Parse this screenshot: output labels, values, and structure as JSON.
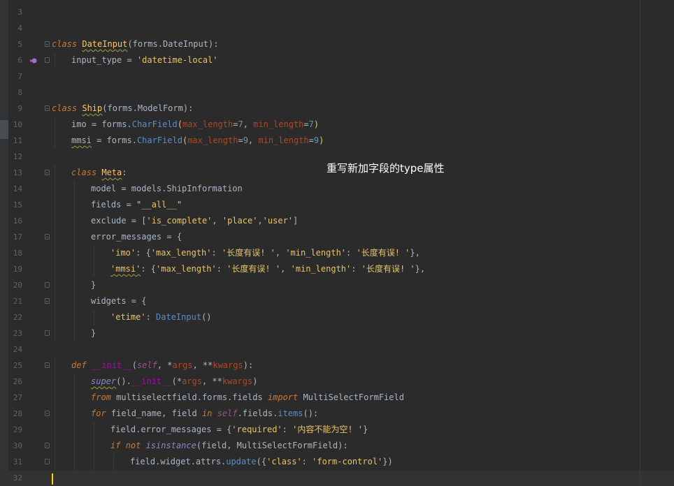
{
  "editor": {
    "language": "python",
    "colors": {
      "background": "#2b2b2b",
      "keyword": "#cc7832",
      "string": "#6a8759",
      "number": "#6897bb",
      "function_call": "#5a8dc7",
      "caret": "#ffd700"
    },
    "annotation": "重写新加字段的type属性",
    "lines": [
      {
        "n": "3"
      },
      {
        "n": "4"
      },
      {
        "n": "5"
      },
      {
        "n": "6"
      },
      {
        "n": "7"
      },
      {
        "n": "8"
      },
      {
        "n": "9"
      },
      {
        "n": "10"
      },
      {
        "n": "11"
      },
      {
        "n": "12"
      },
      {
        "n": "13"
      },
      {
        "n": "14"
      },
      {
        "n": "15"
      },
      {
        "n": "16"
      },
      {
        "n": "17"
      },
      {
        "n": "18"
      },
      {
        "n": "19"
      },
      {
        "n": "20"
      },
      {
        "n": "21"
      },
      {
        "n": "22"
      },
      {
        "n": "23"
      },
      {
        "n": "24"
      },
      {
        "n": "25"
      },
      {
        "n": "26"
      },
      {
        "n": "27"
      },
      {
        "n": "28"
      },
      {
        "n": "29"
      },
      {
        "n": "30"
      },
      {
        "n": "31"
      },
      {
        "n": "32"
      }
    ],
    "tokens": {
      "l5": [
        "class",
        " ",
        "DateInput",
        "(forms.DateInput):"
      ],
      "l6": [
        "input_type",
        " = ",
        "'datetime-local'"
      ],
      "l9": [
        "class",
        " ",
        "Ship",
        "(forms.ModelForm):"
      ],
      "l10": [
        "imo",
        " = forms.",
        "CharField",
        "(",
        "max_length",
        "=",
        "7",
        ", ",
        "min_length",
        "=",
        "7",
        ")"
      ],
      "l11": [
        "mmsi",
        " = forms.",
        "CharField",
        "(",
        "max_length",
        "=",
        "9",
        ", ",
        "min_length",
        "=",
        "9",
        ")"
      ],
      "l13": [
        "class",
        " ",
        "Meta",
        ":"
      ],
      "l14": [
        "model = models.ShipInformation"
      ],
      "l15": [
        "fields = ",
        "\"__all__\""
      ],
      "l16": [
        "exclude = [",
        "'is_complete'",
        ", ",
        "'place'",
        ",",
        "'user'",
        "]"
      ],
      "l17": [
        "error_messages = {"
      ],
      "l18": [
        "'imo'",
        ": {",
        "'max_length'",
        ": ",
        "'长度有误! '",
        ", ",
        "'min_length'",
        ": ",
        "'长度有误! '",
        "},"
      ],
      "l19": [
        "'mmsi'",
        ": {",
        "'max_length'",
        ": ",
        "'长度有误! '",
        ", ",
        "'min_length'",
        ": ",
        "'长度有误! '",
        "},"
      ],
      "l20": [
        "}"
      ],
      "l21": [
        "widgets = {"
      ],
      "l22": [
        "'etime'",
        ": ",
        "DateInput",
        "()"
      ],
      "l23": [
        "}"
      ],
      "l25": [
        "def",
        " ",
        "__init__",
        "(",
        "self",
        ", *",
        "args",
        ", **",
        "kwargs",
        "):"
      ],
      "l26": [
        "super",
        "().",
        "__init__",
        "(*",
        "args",
        ", **",
        "kwargs",
        ")"
      ],
      "l27": [
        "from",
        " multiselectfield.forms.fields ",
        "import",
        " MultiSelectFormField"
      ],
      "l28": [
        "for",
        " field_name, field ",
        "in",
        " ",
        "self",
        ".fields.",
        "items",
        "():"
      ],
      "l29": [
        "field.error_messages = {",
        "'required'",
        ": ",
        "'内容不能为空! '",
        "}"
      ],
      "l30": [
        "if",
        " ",
        "not",
        " ",
        "isinstance",
        "(field, MultiSelectFormField):"
      ],
      "l31": [
        "field.widget.attrs.",
        "update",
        "({",
        "'class'",
        ": ",
        "'form-control'",
        "})"
      ]
    }
  }
}
